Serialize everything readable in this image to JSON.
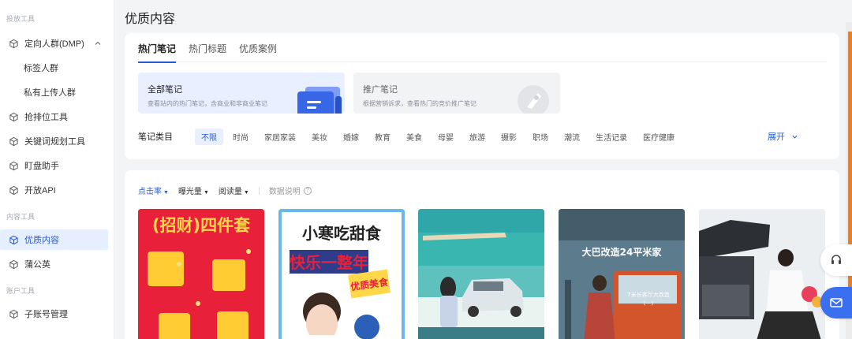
{
  "sidebar": {
    "sections": {
      "ad_tools": "投放工具",
      "content_tools": "内容工具",
      "account_tools": "账户工具"
    },
    "items": [
      {
        "label": "定向人群(DMP)"
      },
      {
        "label": "标签人群"
      },
      {
        "label": "私有上传人群"
      },
      {
        "label": "抢排位工具"
      },
      {
        "label": "关键词规划工具"
      },
      {
        "label": "盯盘助手"
      },
      {
        "label": "开放API"
      },
      {
        "label": "优质内容"
      },
      {
        "label": "蒲公英"
      },
      {
        "label": "子账号管理"
      }
    ]
  },
  "page": {
    "title": "优质内容"
  },
  "tabs": [
    "热门笔记",
    "热门标题",
    "优质案例"
  ],
  "type_cards": [
    {
      "title": "全部笔记",
      "desc": "查看站内的热门笔记，含商业和非商业笔记"
    },
    {
      "title": "推广笔记",
      "desc": "根据营销诉求，查看热门的竞价推广笔记"
    }
  ],
  "categories": {
    "label": "笔记类目",
    "items": [
      "不限",
      "时尚",
      "家居家装",
      "美妆",
      "婚嫁",
      "教育",
      "美食",
      "母婴",
      "旅游",
      "摄影",
      "职场",
      "潮流",
      "生活记录",
      "医疗健康"
    ],
    "expand": "展开"
  },
  "sort": {
    "items": [
      "点击率",
      "曝光量",
      "阅读量"
    ],
    "help": "数据说明"
  },
  "thumbnails": [
    {
      "text_a": "(招财)四件套"
    },
    {
      "text_a": "小寒吃甜食",
      "text_b": "快乐一整年",
      "text_c": "优质美食"
    },
    {},
    {
      "text_a": "大巴改造24平米家",
      "text_b": "7米长客厅大改造",
      "text_c": "(一)"
    },
    {}
  ],
  "colors": {
    "accent": "#2a5bd7",
    "active_bg": "#e6efff",
    "float_blue": "#3a6ff0",
    "orange": "#f07c20"
  }
}
